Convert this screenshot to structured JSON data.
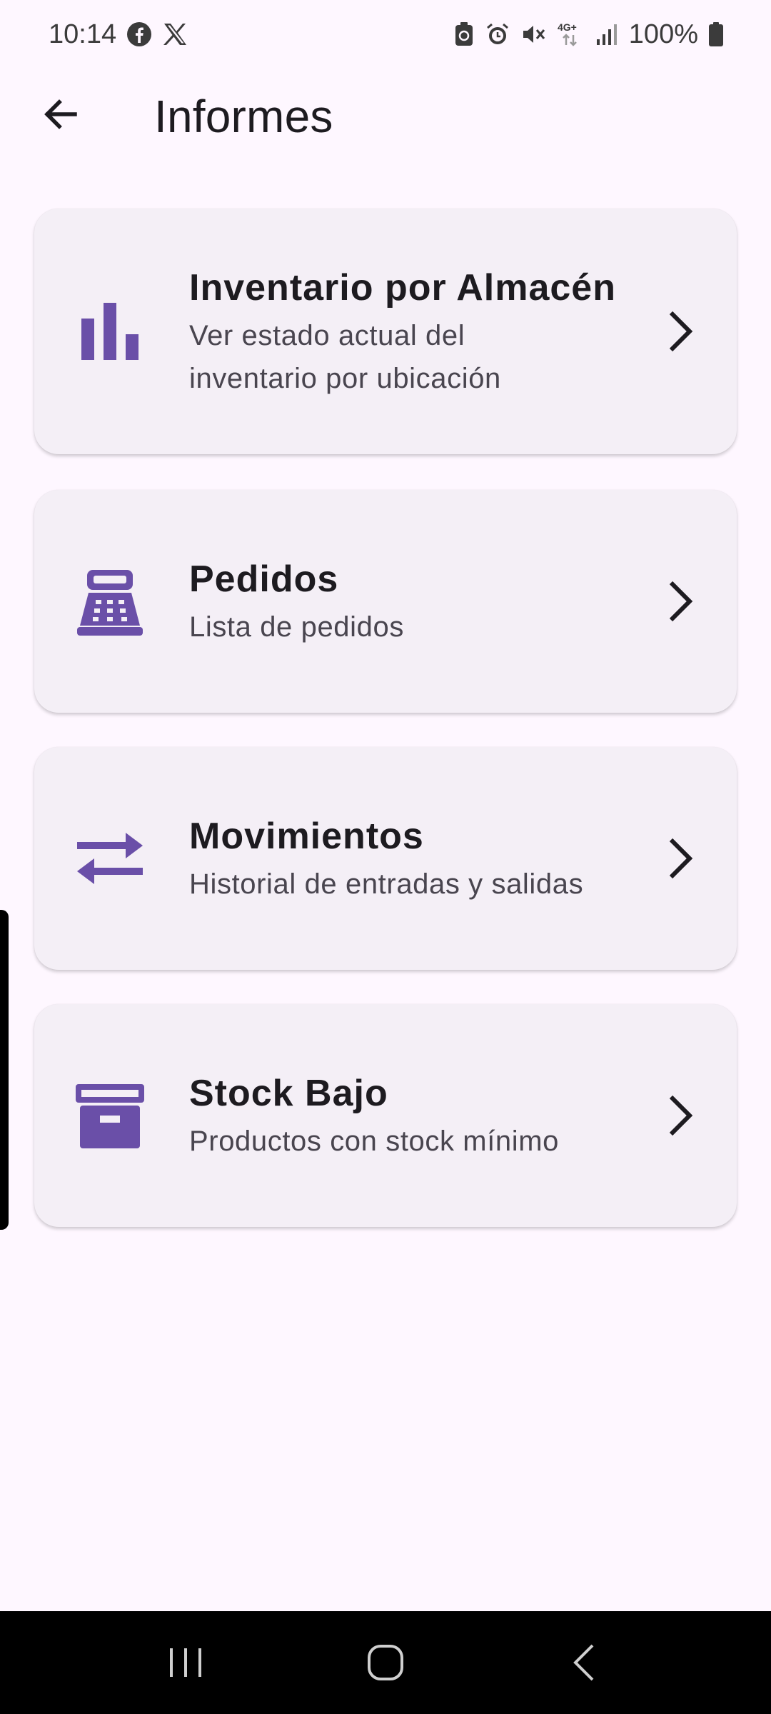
{
  "status_bar": {
    "time": "10:14",
    "battery": "100%",
    "network": "4G+"
  },
  "app_bar": {
    "title": "Informes"
  },
  "cards": [
    {
      "title": "Inventario por Almacén",
      "subtitle_line1": "Ver estado actual del",
      "subtitle_line2": "inventario por ubicación",
      "icon": "bar-chart-icon"
    },
    {
      "title": "Pedidos",
      "subtitle": "Lista de pedidos",
      "icon": "cash-register-icon"
    },
    {
      "title": "Movimientos",
      "subtitle": "Historial de entradas y salidas",
      "icon": "swap-arrows-icon"
    },
    {
      "title": "Stock Bajo",
      "subtitle": "Productos con stock mínimo",
      "icon": "archive-box-icon"
    }
  ],
  "colors": {
    "accent": "#6A4FA8",
    "background": "#FEF7FF",
    "card": "#F4EFF6"
  }
}
